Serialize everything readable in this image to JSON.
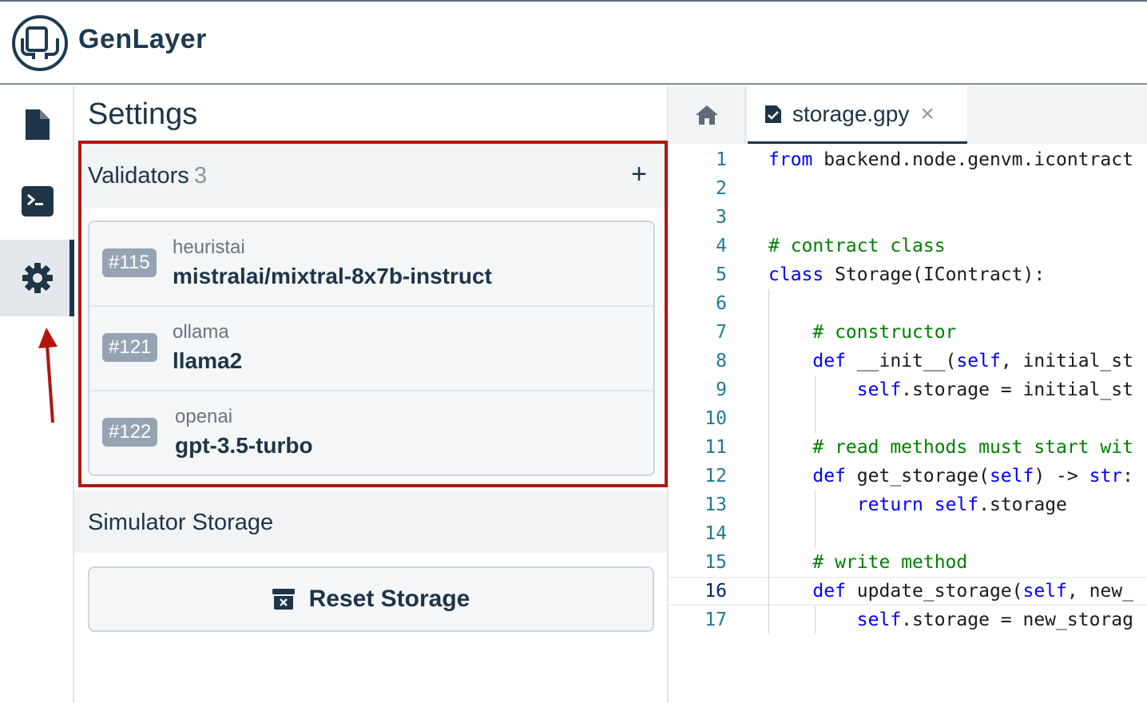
{
  "app": {
    "brand": "GenLayer"
  },
  "rail": {
    "items": [
      "contracts",
      "terminal",
      "settings"
    ],
    "active": "settings"
  },
  "settings": {
    "title": "Settings",
    "validators": {
      "label": "Validators",
      "count": "3",
      "add_label": "+",
      "items": [
        {
          "id": "#115",
          "provider": "heuristai",
          "model": "mistralai/mixtral-8x7b-instruct"
        },
        {
          "id": "#121",
          "provider": "ollama",
          "model": "llama2"
        },
        {
          "id": "#122",
          "provider": "openai",
          "model": "gpt-3.5-turbo"
        }
      ]
    },
    "simulator_storage": {
      "label": "Simulator Storage",
      "reset_label": "Reset Storage"
    }
  },
  "editor": {
    "tab": {
      "name": "storage.gpy",
      "close": "×"
    },
    "current_line": 16,
    "lines": [
      {
        "n": "1",
        "tokens": [
          [
            "kw",
            "from"
          ],
          [
            "t",
            " backend.node.genvm.icontract"
          ]
        ]
      },
      {
        "n": "2",
        "tokens": []
      },
      {
        "n": "3",
        "tokens": []
      },
      {
        "n": "4",
        "tokens": [
          [
            "cm",
            "# contract class"
          ]
        ]
      },
      {
        "n": "5",
        "tokens": [
          [
            "kw",
            "class"
          ],
          [
            "t",
            " Storage(IContract):"
          ]
        ]
      },
      {
        "n": "6",
        "tokens": []
      },
      {
        "n": "7",
        "tokens": [
          [
            "t",
            "    "
          ],
          [
            "cm",
            "# constructor"
          ]
        ]
      },
      {
        "n": "8",
        "tokens": [
          [
            "t",
            "    "
          ],
          [
            "kw",
            "def"
          ],
          [
            "t",
            " __init__("
          ],
          [
            "kw",
            "self"
          ],
          [
            "t",
            ", initial_st"
          ]
        ]
      },
      {
        "n": "9",
        "tokens": [
          [
            "t",
            "        "
          ],
          [
            "kw",
            "self"
          ],
          [
            "t",
            ".storage = initial_st"
          ]
        ]
      },
      {
        "n": "10",
        "tokens": []
      },
      {
        "n": "11",
        "tokens": [
          [
            "t",
            "    "
          ],
          [
            "cm",
            "# read methods must start wit"
          ]
        ]
      },
      {
        "n": "12",
        "tokens": [
          [
            "t",
            "    "
          ],
          [
            "kw",
            "def"
          ],
          [
            "t",
            " get_storage("
          ],
          [
            "kw",
            "self"
          ],
          [
            "t",
            ") -> "
          ],
          [
            "kw",
            "str"
          ],
          [
            "t",
            ":"
          ]
        ]
      },
      {
        "n": "13",
        "tokens": [
          [
            "t",
            "        "
          ],
          [
            "kw",
            "return"
          ],
          [
            "t",
            " "
          ],
          [
            "kw",
            "self"
          ],
          [
            "t",
            ".storage"
          ]
        ]
      },
      {
        "n": "14",
        "tokens": []
      },
      {
        "n": "15",
        "tokens": [
          [
            "t",
            "    "
          ],
          [
            "cm",
            "# write method"
          ]
        ]
      },
      {
        "n": "16",
        "tokens": [
          [
            "t",
            "    "
          ],
          [
            "kw",
            "def"
          ],
          [
            "t",
            " update_storage("
          ],
          [
            "kw",
            "self"
          ],
          [
            "t",
            ", new_"
          ]
        ]
      },
      {
        "n": "17",
        "tokens": [
          [
            "t",
            "        "
          ],
          [
            "kw",
            "self"
          ],
          [
            "t",
            ".storage = new_storag"
          ]
        ]
      }
    ]
  },
  "colors": {
    "primary": "#1e3447",
    "highlight_border": "#b0160f",
    "badge": "#96a3b2",
    "annotation_arrow": "#b0160f"
  }
}
